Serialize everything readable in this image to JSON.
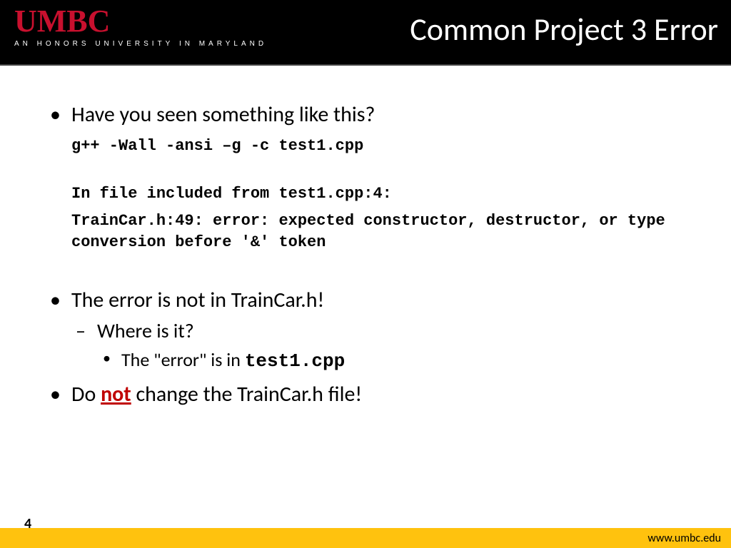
{
  "header": {
    "logo_main": "UMBC",
    "logo_sub": "AN HONORS UNIVERSITY IN MARYLAND",
    "title": "Common Project 3 Error"
  },
  "bullets": {
    "b1": "Have you seen something like this?",
    "code1": "g++ -Wall -ansi –g -c test1.cpp",
    "code2": "In file included from test1.cpp:4:",
    "code3": "TrainCar.h:49: error: expected constructor, destructor, or type conversion before '&' token",
    "b2": "The error is not in TrainCar.h!",
    "b2_sub1": "Where is it?",
    "b2_sub2_pre": "The \"error\" is in ",
    "b2_sub2_code": "test1.cpp",
    "b3_pre": "Do ",
    "b3_not": "not",
    "b3_post": " change the TrainCar.h file!"
  },
  "footer": {
    "page": "4",
    "url": "www.umbc.edu"
  }
}
